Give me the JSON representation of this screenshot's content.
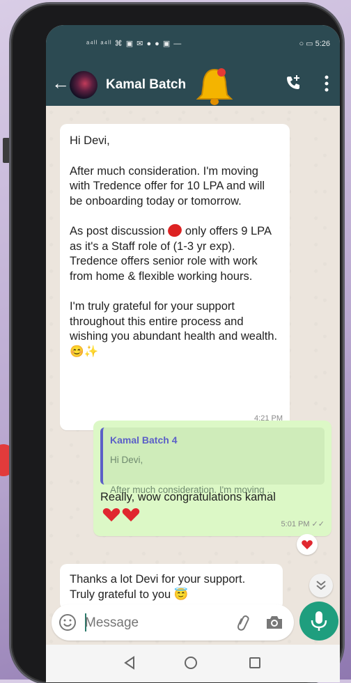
{
  "status_bar": {
    "left_icons": "ᵃ⁴ˡˡ ᵃ⁴ˡˡ ⌘ ▣ ✉ ● ● ▣ ―",
    "right_text": "○ ▭ 5:26"
  },
  "header": {
    "contact_name": "Kamal Batch"
  },
  "messages": {
    "m1": {
      "p1": "Hi Devi,",
      "p2": "After much consideration. I'm moving with Tredence offer for 10 LPA and will be onboarding today or tomorrow.",
      "p3a": "As post discussion",
      "p3b": "only offers 9 LPA as it's a Staff role of (1-3 yr exp). Tredence offers senior role with work from home & flexible working hours.",
      "p4": "I'm truly grateful for your support throughout this entire process and wishing you abundant health and wealth.",
      "p4_emoji": "😊✨",
      "time": "4:21 PM"
    },
    "m2": {
      "quote_name": "Kamal Batch 4",
      "quote_line1": "Hi Devi,",
      "quote_line2": "After much consideration. I'm moving ...",
      "text": "Really, wow congratulations kamal",
      "time": "5:01 PM ✓✓"
    },
    "m3": {
      "text": "Thanks a lot Devi for your support. Truly grateful to you",
      "emoji": "😇"
    }
  },
  "composer": {
    "placeholder": "Message"
  },
  "colors": {
    "header_bg": "#2c4a52",
    "chat_bg": "#ece5dd",
    "outgoing_bubble": "#dcf8c6",
    "mic_button": "#1f9e7e",
    "quote_accent": "#5b5fc7"
  },
  "icons": {
    "back": "arrow-left-icon",
    "avatar": "avatar",
    "bell": "bell-icon",
    "call": "add-call-icon",
    "menu": "more-vert-icon",
    "emoji": "emoji-icon",
    "attach": "paperclip-icon",
    "camera": "camera-icon",
    "mic": "mic-icon",
    "scroll_down": "double-chevron-down-icon",
    "nav_back": "triangle-back-icon",
    "nav_home": "circle-home-icon",
    "nav_recent": "square-recents-icon"
  }
}
